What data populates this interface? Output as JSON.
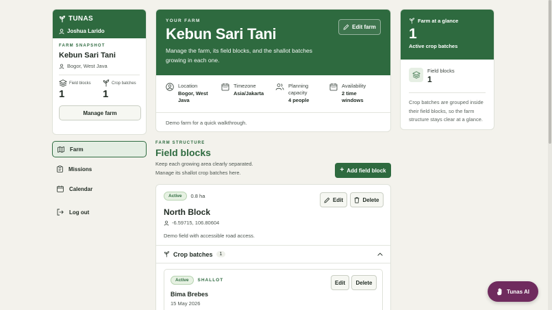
{
  "sidebar": {
    "brand": "TUNAS",
    "user_name": "Joshua Larido",
    "snapshot_eyebrow": "FARM SNAPSHOT",
    "farm_name": "Kebun Sari Tani",
    "location": "Bogor, West Java",
    "stats": [
      {
        "label": "Field blocks",
        "value": "1"
      },
      {
        "label": "Crop batches",
        "value": "1"
      }
    ],
    "manage_label": "Manage farm",
    "nav": [
      {
        "label": "Farm"
      },
      {
        "label": "Missions"
      },
      {
        "label": "Calendar"
      },
      {
        "label": "Log out"
      }
    ]
  },
  "hero": {
    "eyebrow": "YOUR FARM",
    "title": "Kebun Sari Tani",
    "description": "Manage the farm, its field blocks, and the shallot batches growing in each one.",
    "edit_label": "Edit farm",
    "meta": [
      {
        "label": "Location",
        "value": "Bogor, West Java",
        "icon": "person-pin-icon"
      },
      {
        "label": "Timezone",
        "value": "Asia/Jakarta",
        "icon": "calendar-icon"
      },
      {
        "label": "Planning capacity",
        "value": "4 people",
        "icon": "people-icon"
      },
      {
        "label": "Availability",
        "value": "2 time windows",
        "icon": "calendar-icon"
      }
    ],
    "footnote": "Demo farm for a quick walkthrough."
  },
  "glance": {
    "title": "Farm at a glance",
    "number": "1",
    "subtitle": "Active crop batches",
    "field_blocks_label": "Field blocks",
    "field_blocks_value": "1",
    "note": "Crop batches are grouped inside their field blocks, so the farm structure stays clear at a glance."
  },
  "structure": {
    "eyebrow": "FARM STRUCTURE",
    "title": "Field blocks",
    "description": "Keep each growing area clearly separated. Manage its shallot crop batches here.",
    "add_label": "Add field block"
  },
  "block": {
    "status": "Active",
    "size": "0.8 ha",
    "name": "North Block",
    "coords": "-6.59715, 106.80604",
    "note": "Demo field with accessible road access.",
    "edit_label": "Edit",
    "delete_label": "Delete",
    "crop_label": "Crop batches",
    "crop_count": "1"
  },
  "batch": {
    "status": "Active",
    "type": "SHALLOT",
    "name": "Bima Brebes",
    "date": "15 May 2026",
    "edit_label": "Edit",
    "delete_label": "Delete"
  },
  "assistant": {
    "label": "Tunas AI"
  },
  "colors": {
    "primary": "#2e6a3f",
    "background": "#f3f2ec",
    "assistant": "#6f2b5e"
  }
}
